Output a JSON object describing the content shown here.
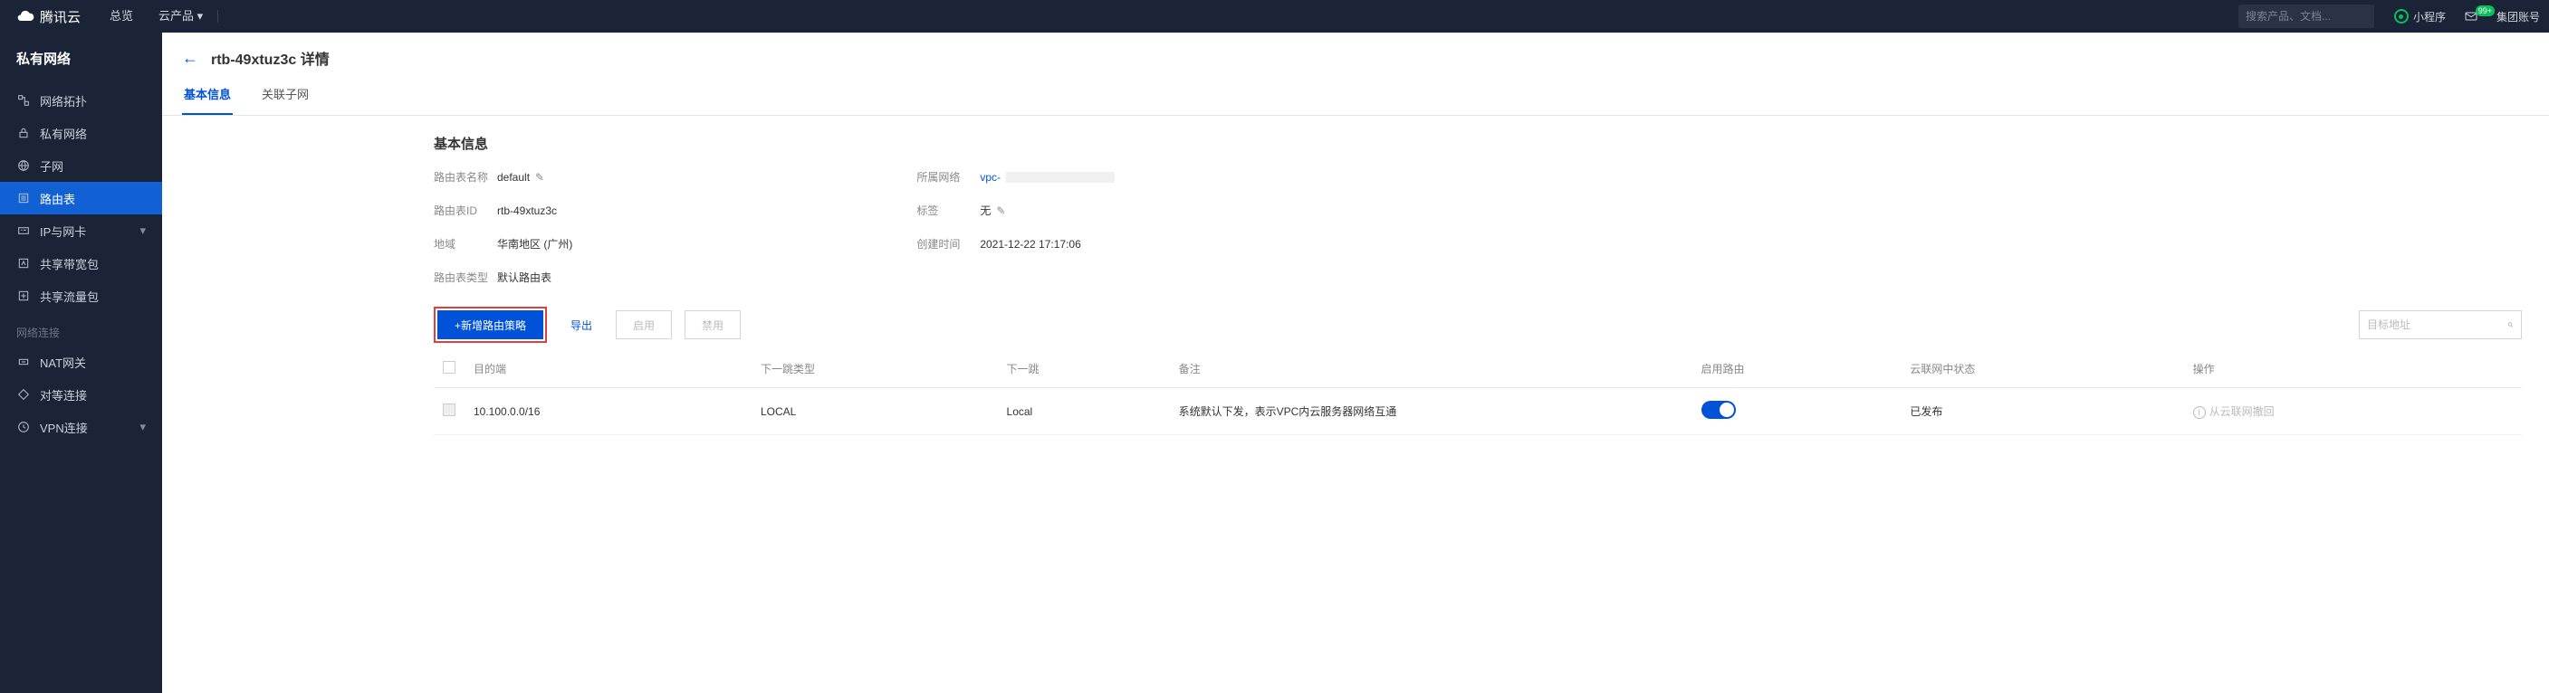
{
  "topbar": {
    "brand": "腾讯云",
    "nav": [
      "总览",
      "云产品 ▾"
    ],
    "search_placeholder": "搜索产品、文档...",
    "right": {
      "mini": "小程序",
      "mail_badge": "99+",
      "account": "集团账号"
    }
  },
  "sidebar": {
    "title": "私有网络",
    "items": [
      {
        "icon": "topology",
        "label": "网络拓扑"
      },
      {
        "icon": "lock",
        "label": "私有网络"
      },
      {
        "icon": "globe",
        "label": "子网"
      },
      {
        "icon": "list",
        "label": "路由表",
        "active": true
      },
      {
        "icon": "ip",
        "label": "IP与网卡",
        "chevron": true
      },
      {
        "icon": "bw",
        "label": "共享带宽包"
      },
      {
        "icon": "flow",
        "label": "共享流量包"
      }
    ],
    "group_label": "网络连接",
    "group_items": [
      {
        "icon": "nat",
        "label": "NAT网关"
      },
      {
        "icon": "peer",
        "label": "对等连接"
      },
      {
        "icon": "vpn",
        "label": "VPN连接",
        "chevron": true
      }
    ]
  },
  "breadcrumb": {
    "title": "rtb-49xtuz3c 详情"
  },
  "tabs": [
    {
      "label": "基本信息",
      "active": true
    },
    {
      "label": "关联子网"
    }
  ],
  "panel": {
    "title": "基本信息",
    "left": {
      "name_label": "路由表名称",
      "name_value": "default",
      "id_label": "路由表ID",
      "id_value": "rtb-49xtuz3c",
      "region_label": "地域",
      "region_value": "华南地区 (广州)",
      "type_label": "路由表类型",
      "type_value": "默认路由表"
    },
    "right": {
      "vpc_label": "所属网络",
      "vpc_value": "vpc-",
      "tag_label": "标签",
      "tag_value": "无",
      "ctime_label": "创建时间",
      "ctime_value": "2021-12-22 17:17:06"
    }
  },
  "actions": {
    "add": "+新增路由策略",
    "export": "导出",
    "enable": "启用",
    "disable": "禁用",
    "search_placeholder": "目标地址"
  },
  "table": {
    "headers": [
      "目的端",
      "下一跳类型",
      "下一跳",
      "备注",
      "启用路由",
      "云联网中状态",
      "操作"
    ],
    "rows": [
      {
        "dest": "10.100.0.0/16",
        "hop_type": "LOCAL",
        "hop": "Local",
        "note": "系统默认下发，表示VPC内云服务器网络互通",
        "enabled": true,
        "ccn_status": "已发布",
        "op": "从云联网撤回"
      }
    ]
  }
}
